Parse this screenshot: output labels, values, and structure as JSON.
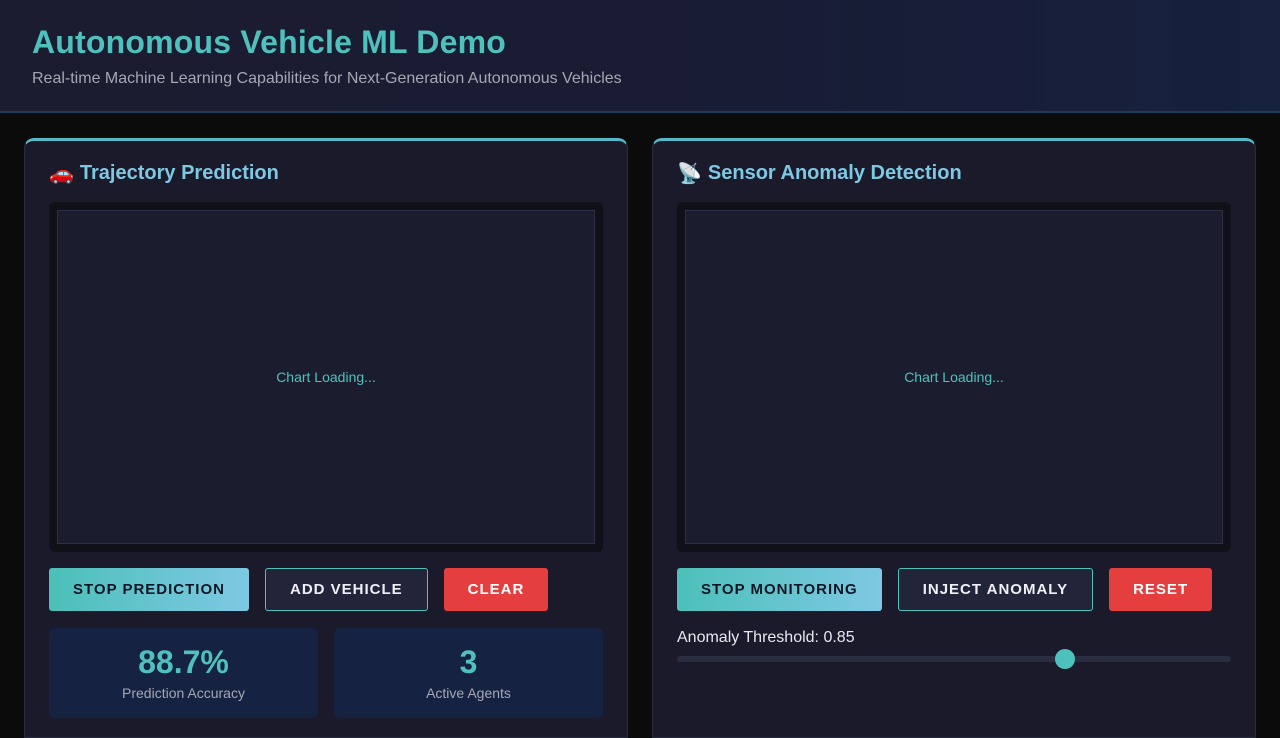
{
  "header": {
    "title": "Autonomous Vehicle ML Demo",
    "subtitle": "Real-time Machine Learning Capabilities for Next-Generation Autonomous Vehicles"
  },
  "trajectory": {
    "icon": "car-icon",
    "icon_glyph": "🚗",
    "title": "Trajectory Prediction",
    "chart_status": "Chart Loading...",
    "buttons": {
      "stop": "STOP PREDICTION",
      "add": "ADD VEHICLE",
      "clear": "CLEAR"
    },
    "stats": [
      {
        "value": "88.7%",
        "label": "Prediction Accuracy"
      },
      {
        "value": "3",
        "label": "Active Agents"
      }
    ]
  },
  "anomaly": {
    "icon": "satellite-dish-icon",
    "icon_glyph": "📡",
    "title": "Sensor Anomaly Detection",
    "chart_status": "Chart Loading...",
    "buttons": {
      "stop": "STOP MONITORING",
      "inject": "INJECT ANOMALY",
      "reset": "RESET"
    },
    "threshold_label": "Anomaly Threshold: 0.85",
    "threshold_slider_fraction": 0.7
  },
  "colors": {
    "accent": "#4fc1bd",
    "accent_light": "#7ec8e3",
    "danger": "#e53e3e",
    "panel": "#1a1a2b",
    "background": "#0b0b0c"
  }
}
